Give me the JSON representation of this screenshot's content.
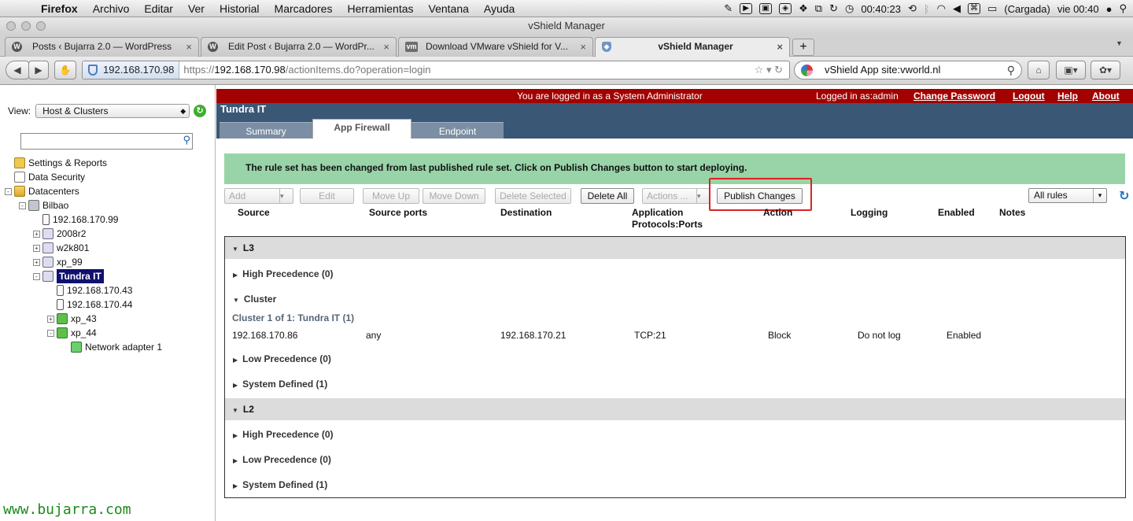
{
  "menubar": {
    "app": "Firefox",
    "items": [
      "Archivo",
      "Editar",
      "Ver",
      "Historial",
      "Marcadores",
      "Herramientas",
      "Ventana",
      "Ayuda"
    ],
    "clock_elapsed": "00:40:23",
    "battery": "(Cargada)",
    "datetime": "vie 00:40"
  },
  "window": {
    "title": "vShield Manager"
  },
  "tabs": [
    {
      "label": "Posts ‹ Bujarra 2.0 — WordPress",
      "active": false
    },
    {
      "label": "Edit Post ‹ Bujarra 2.0 — WordPr...",
      "active": false
    },
    {
      "label": "Download VMware vShield for V...",
      "active": false
    },
    {
      "label": "vShield Manager",
      "active": true
    }
  ],
  "navbar": {
    "identity": "192.168.170.98",
    "url_prefix": "https://",
    "url_host": "192.168.170.98",
    "url_path": "/actionItems.do?operation=login",
    "search_value": "vShield App site:vworld.nl"
  },
  "sidebar": {
    "view_label": "View:",
    "view_value": "Host & Clusters",
    "search_placeholder": "",
    "tree": [
      {
        "label": "Settings & Reports",
        "icon": "settings-icon",
        "depth": 0,
        "exp": ""
      },
      {
        "label": "Data Security",
        "icon": "document-icon",
        "depth": 0,
        "exp": ""
      },
      {
        "label": "Datacenters",
        "icon": "folder-icon",
        "depth": 0,
        "exp": "-"
      },
      {
        "label": "Bilbao",
        "icon": "datacenter-icon",
        "depth": 1,
        "exp": "-"
      },
      {
        "label": "192.168.170.99",
        "icon": "server-icon",
        "depth": 2,
        "exp": ""
      },
      {
        "label": "2008r2",
        "icon": "host-icon",
        "depth": 2,
        "exp": "+"
      },
      {
        "label": "w2k801",
        "icon": "host-icon",
        "depth": 2,
        "exp": "+"
      },
      {
        "label": "xp_99",
        "icon": "host-icon",
        "depth": 2,
        "exp": "+"
      },
      {
        "label": "Tundra IT",
        "icon": "cluster-icon",
        "depth": 2,
        "exp": "-",
        "selected": true
      },
      {
        "label": "192.168.170.43",
        "icon": "server-icon",
        "depth": 3,
        "exp": ""
      },
      {
        "label": "192.168.170.44",
        "icon": "server-icon",
        "depth": 3,
        "exp": ""
      },
      {
        "label": "xp_43",
        "icon": "vm-icon",
        "depth": 3,
        "exp": "+"
      },
      {
        "label": "xp_44",
        "icon": "vm-icon",
        "depth": 3,
        "exp": "-"
      },
      {
        "label": "Network adapter 1",
        "icon": "network-adapter-icon",
        "depth": 4,
        "exp": ""
      }
    ],
    "watermark": "www.bujarra.com"
  },
  "header": {
    "logged_msg": "You are logged in as a System Administrator",
    "logged_as": "Logged in as:admin",
    "links": {
      "change_password": "Change Password",
      "logout": "Logout",
      "help": "Help",
      "about": "About"
    },
    "title": "Tundra IT",
    "tabs": [
      "Summary",
      "App Firewall",
      "Endpoint"
    ]
  },
  "notice": "The rule set has been changed from last published rule set. Click on Publish Changes button to start deploying.",
  "toolbar": {
    "add": "Add",
    "edit": "Edit",
    "move_up": "Move Up",
    "move_down": "Move Down",
    "delete_selected": "Delete Selected",
    "delete_all": "Delete All",
    "actions": "Actions ...",
    "publish": "Publish Changes",
    "filter": "All rules"
  },
  "columns": {
    "source": "Source",
    "source_ports": "Source ports",
    "destination": "Destination",
    "app_protocols_1": "Application",
    "app_protocols_2": "Protocols:Ports",
    "action": "Action",
    "logging": "Logging",
    "enabled": "Enabled",
    "notes": "Notes"
  },
  "rules": {
    "l3": {
      "title": "L3",
      "high": "High Precedence (0)",
      "cluster": "Cluster",
      "cluster_title": "Cluster 1 of 1: Tundra IT (1)",
      "row": {
        "source": "192.168.170.86",
        "source_ports": "any",
        "destination": "192.168.170.21",
        "app": "TCP:21",
        "action": "Block",
        "logging": "Do not log",
        "enabled": "Enabled"
      },
      "low": "Low Precedence (0)",
      "system": "System Defined (1)"
    },
    "l2": {
      "title": "L2",
      "high": "High Precedence (0)",
      "low": "Low Precedence (0)",
      "system": "System Defined (1)"
    }
  }
}
